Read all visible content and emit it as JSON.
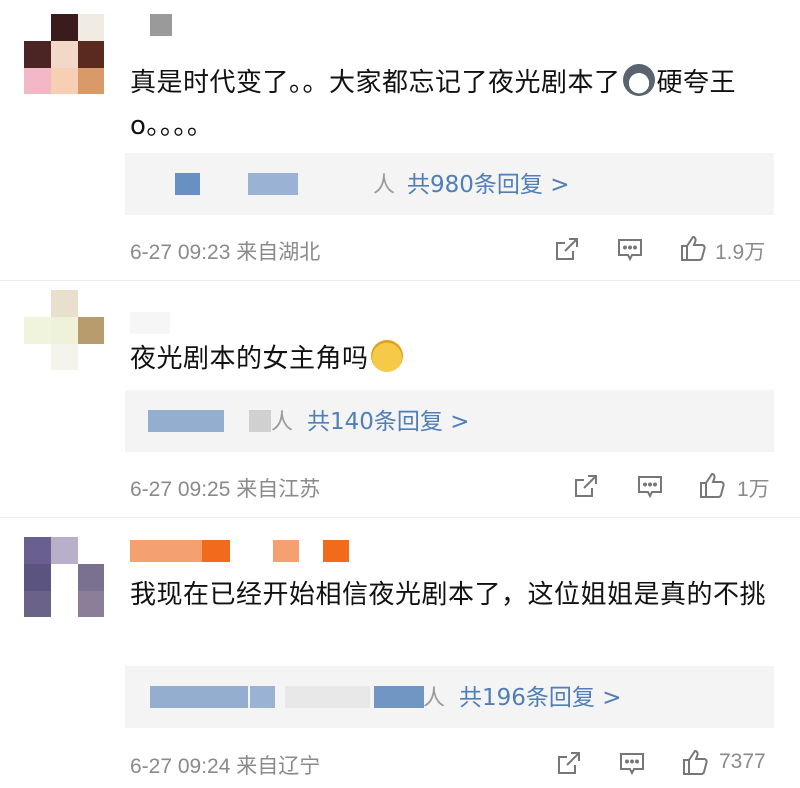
{
  "comments": [
    {
      "text": "真是时代变了。。大家都忘记了夜光剧本了",
      "text_tail": "硬夸王o。。。。",
      "emoji": "husky-dog-emoji",
      "reply_ren": "人",
      "reply_link": "共980条回复 >",
      "time": "6-27 09:23",
      "source": "来自湖北",
      "likes": "1.9万"
    },
    {
      "text": "夜光剧本的女主角吗",
      "emoji": "laughing-tears-emoji",
      "reply_ren": "人",
      "reply_link": "共140条回复 >",
      "time": "6-27 09:25",
      "source": "来自江苏",
      "likes": "1万"
    },
    {
      "text": "我现在已经开始相信夜光剧本了，这位姐姐是真的不挑",
      "reply_ren": "人",
      "reply_link": "共196条回复 >",
      "time": "6-27 09:24",
      "source": "来自辽宁",
      "likes": "7377"
    }
  ],
  "colors": {
    "link": "#4f7eb8",
    "meta": "#8a8a8a",
    "reply_bg": "#f4f4f4"
  },
  "icons": [
    "share-icon",
    "comment-icon",
    "like-icon"
  ]
}
